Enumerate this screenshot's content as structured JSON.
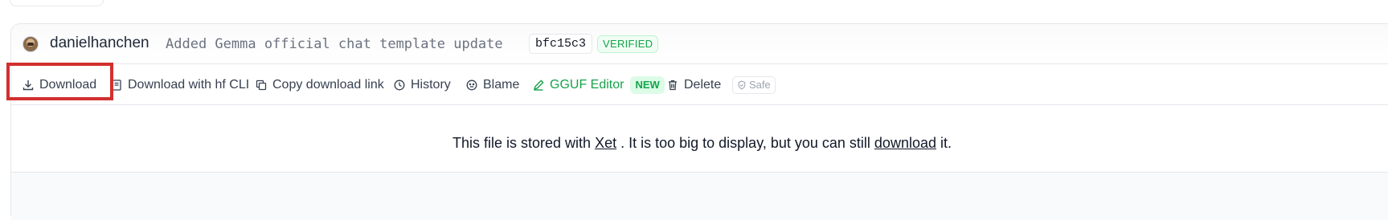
{
  "commit": {
    "author": "danielhanchen",
    "message": "Added Gemma official chat template update",
    "sha": "bfc15c3",
    "verified_label": "VERIFIED"
  },
  "toolbar": {
    "download": "Download",
    "download_cli": "Download with hf CLI",
    "copy_link": "Copy download link",
    "history": "History",
    "blame": "Blame",
    "gguf_editor": "GGUF Editor",
    "new_badge": "NEW",
    "delete": "Delete",
    "safe": "Safe"
  },
  "content": {
    "part1": "This file is stored with ",
    "xet_link": "Xet",
    "part2": " . It is too big to display, but you can still ",
    "download_link": "download",
    "part3": " it."
  },
  "colors": {
    "accent_green": "#16a34a",
    "highlight_red": "#d32f2f",
    "border": "#e5e7eb"
  }
}
